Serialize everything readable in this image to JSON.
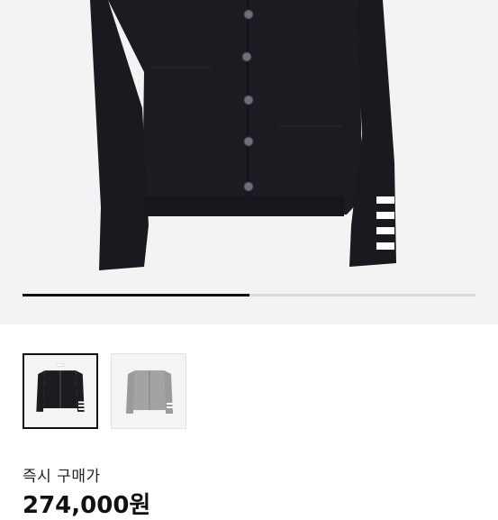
{
  "product": {
    "gallery": {
      "image": "black-knit-cardigan",
      "current_slide": 1,
      "total_slides": 2,
      "progress_fraction": 0.5,
      "thumbnails": [
        {
          "image": "black-knit-cardigan",
          "color": "#1a1c22",
          "selected": true
        },
        {
          "image": "grey-knit-cardigan",
          "color": "#9b9b9b",
          "selected": false
        }
      ]
    },
    "purchase_label": "즉시 구매가",
    "price": "274,000원"
  },
  "colors": {
    "hero_background": "#f3f3f3",
    "progress_fill": "#111111",
    "progress_track": "#d9d9d9"
  }
}
